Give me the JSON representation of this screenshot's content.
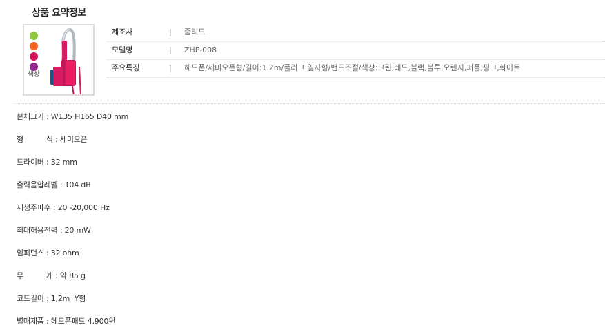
{
  "section_title": "상품 요약정보",
  "thumbnail": {
    "color_label": "색상",
    "dot_colors": [
      "#8cc63f",
      "#f26522",
      "#d4145a",
      "#92278f"
    ],
    "product_colors": {
      "band": "#b0b8c2",
      "body": "#d81b60",
      "earcup": "#c2185b",
      "accent": "#1e4d8c"
    }
  },
  "summary": [
    {
      "label": "제조사",
      "sep": "|",
      "value": "줌리드"
    },
    {
      "label": "모델명",
      "sep": "|",
      "value": "ZHP-008"
    },
    {
      "label": "주요특징",
      "sep": "|",
      "value": "헤드폰/세미오픈형/길이:1.2m/플러그:일자형/밴드조절/색상:그린,레드,블랙,블루,오렌지,퍼플,핑크,화이트"
    }
  ],
  "specs": [
    "본체크기 : W135 H165 D40 mm",
    "형          식 : 세미오픈",
    "드라이버 : 32 mm",
    "출력음압레벨 : 104 dB",
    "재생주파수 : 20 -20,000 Hz",
    "최대허용전력 : 20 mW",
    "임피던스 : 32 ohm",
    "무          게 : 약 85 g",
    "코드길이 : 1,2m  Y형",
    "별매제품 : 헤드폰패드 4,900원"
  ]
}
